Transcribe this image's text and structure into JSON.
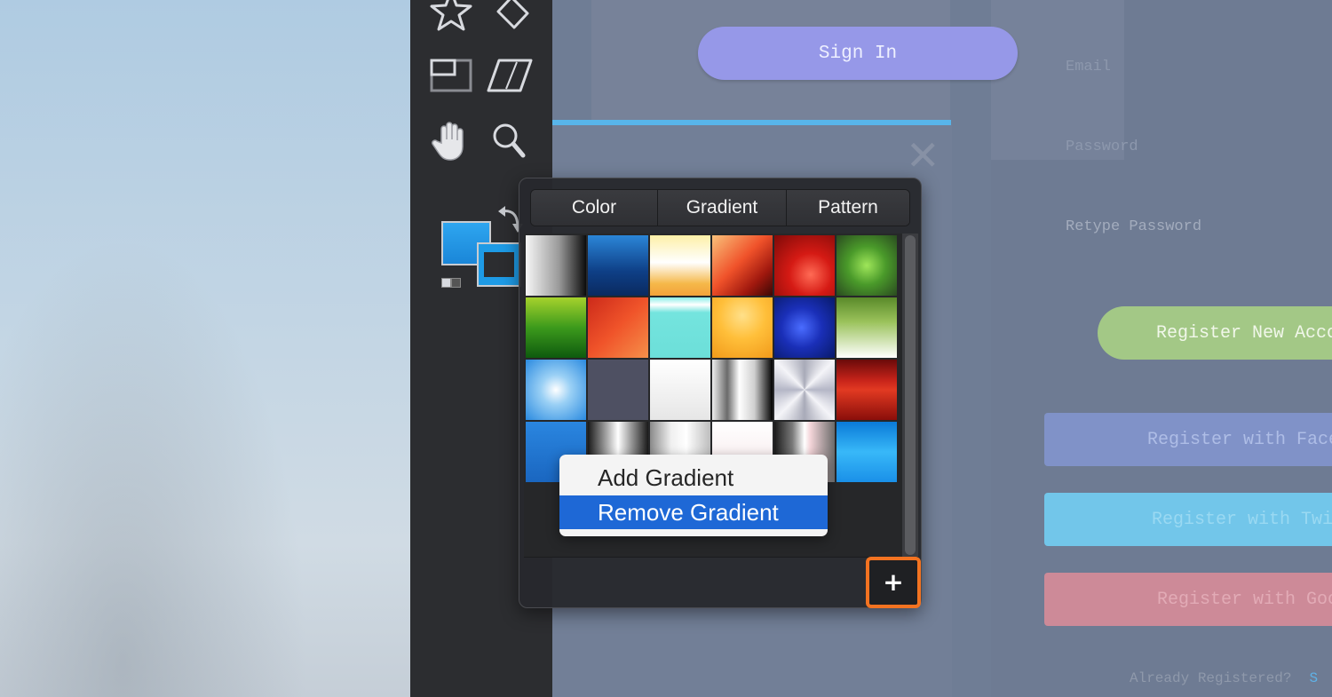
{
  "popover": {
    "tabs": [
      "Color",
      "Gradient",
      "Pattern"
    ],
    "add_button_label": "+"
  },
  "context_menu": {
    "items": [
      "Add Gradient",
      "Remove Gradient"
    ]
  },
  "toolbar": {
    "icons": [
      "star-icon",
      "diamond-icon",
      "frame-icon",
      "parallelogram-icon",
      "hand-icon",
      "magnifier-icon",
      "swap-colors-icon"
    ]
  },
  "background_form": {
    "sign_in": "Sign In",
    "email_label": "Email",
    "password_label": "Password",
    "retype_label": "Retype Password",
    "register_new": "Register New Accou",
    "register_facebook": "Register with Faceb",
    "register_twitter": "Register with Twit",
    "register_google": "Register with Goog",
    "already_registered": "Already Registered?",
    "sign_in_link": "S"
  },
  "colors": {
    "toolbar": "#2c2d30",
    "canvas": "#6f7d95",
    "sign_in_button": "#9698e8",
    "register_new": "#a3c886",
    "facebook": "#8092c8",
    "twitter": "#72c6ea",
    "google": "#cd8a98",
    "highlight": "#1e68d6",
    "add_button_outline": "#f37321"
  }
}
